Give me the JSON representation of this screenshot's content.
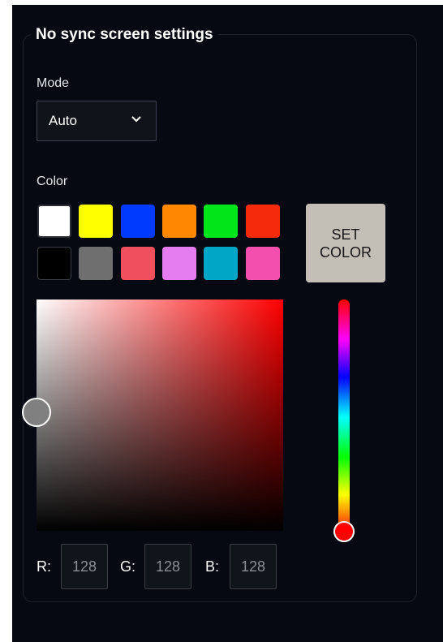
{
  "panel": {
    "title": "No sync screen settings"
  },
  "mode": {
    "label": "Mode",
    "value": "Auto"
  },
  "color": {
    "label": "Color",
    "set_button_label": "SET\nCOLOR",
    "swatches": [
      {
        "name": "white",
        "hex": "#ffffff"
      },
      {
        "name": "yellow",
        "hex": "#ffff00"
      },
      {
        "name": "blue",
        "hex": "#0039ff"
      },
      {
        "name": "orange",
        "hex": "#ff8800"
      },
      {
        "name": "green",
        "hex": "#00e619"
      },
      {
        "name": "red",
        "hex": "#f52a0c"
      },
      {
        "name": "black",
        "hex": "#000000"
      },
      {
        "name": "gray",
        "hex": "#6f6f6f"
      },
      {
        "name": "coral",
        "hex": "#f0505e"
      },
      {
        "name": "violet",
        "hex": "#e47bef"
      },
      {
        "name": "teal",
        "hex": "#01a6c6"
      },
      {
        "name": "pink",
        "hex": "#f24fae"
      }
    ],
    "hue": 0,
    "saturation_level": 0,
    "brightness_level": 0.5
  },
  "rgb": {
    "r_label": "R:",
    "g_label": "G:",
    "b_label": "B:",
    "r": "128",
    "g": "128",
    "b": "128"
  },
  "colors": {
    "background": "#060812",
    "panel_border": "#1e222d",
    "set_button_bg": "#c4bfb6",
    "current_color": "#808080"
  }
}
